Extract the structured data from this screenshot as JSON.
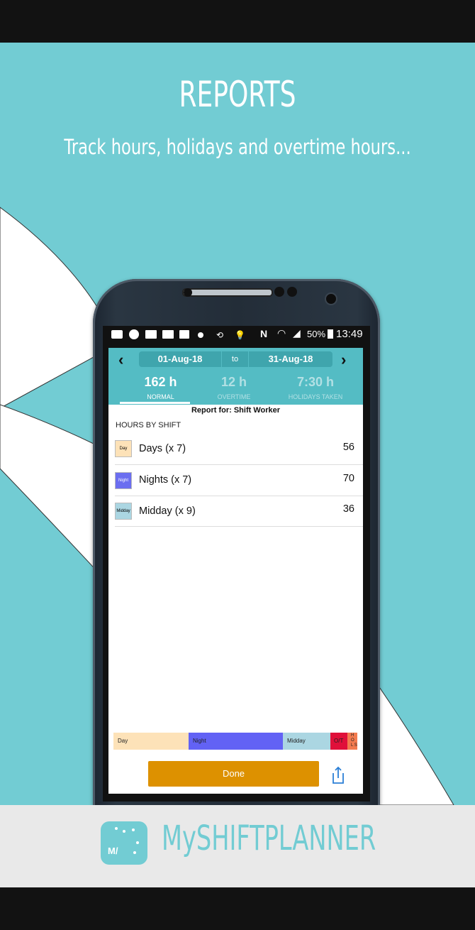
{
  "marketing": {
    "headline": "REPORTS",
    "subline": "Track hours, holidays and overtime hours..."
  },
  "status_bar": {
    "battery": "50%",
    "time": "13:49"
  },
  "app": {
    "range": {
      "start": "01-Aug-18",
      "separator": "to",
      "end": "31-Aug-18"
    },
    "stats": [
      {
        "value": "162 h",
        "label": "NORMAL"
      },
      {
        "value": "12 h",
        "label": "OVERTIME"
      },
      {
        "value": "7:30 h",
        "label": "HOLIDAYS TAKEN"
      }
    ],
    "report_for": "Report for: Shift Worker",
    "section_title": "HOURS BY SHIFT",
    "shifts": [
      {
        "swatch": "Day",
        "label": "Days (x 7)",
        "hours": "56",
        "color": "#fde2b8"
      },
      {
        "swatch": "Night",
        "label": "Nights (x 7)",
        "hours": "70",
        "color": "#6b6ef0"
      },
      {
        "swatch": "Midday",
        "label": "Midday (x 9)",
        "hours": "36",
        "color": "#abd6e2"
      }
    ],
    "breakdown_bar": {
      "labels": {
        "day": "Day",
        "night": "Night",
        "midday": "Midday",
        "ot": "O/T",
        "hol": "H O L S"
      },
      "colors": {
        "day": "#fde2b8",
        "night": "#6262f5",
        "midday": "#abd6e2",
        "ot": "#e0103a",
        "hol": "#f37b4f"
      }
    },
    "done_label": "Done"
  },
  "brand": {
    "name": "MySHIFTPLANNER",
    "logo_mark": "M/"
  }
}
